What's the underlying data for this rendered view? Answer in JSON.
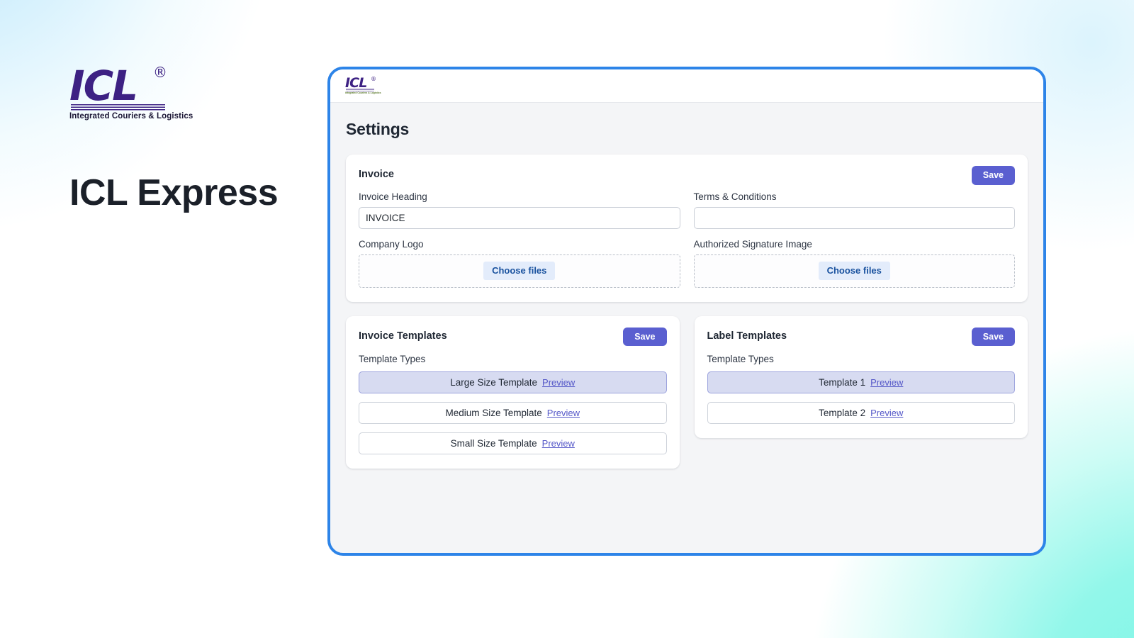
{
  "brand": {
    "logo_wordmark": "ICL",
    "logo_registered": "®",
    "logo_tagline": "Integrated Couriers & Logistics",
    "title": "ICL Express",
    "purple": "#3d2183"
  },
  "app": {
    "border_color": "#2d84e8",
    "body_bg": "#f4f5f7",
    "header": {
      "logo_wordmark": "ICL",
      "logo_registered": "®",
      "logo_tagline": "Integrated Couriers & Logistics"
    },
    "page_title": "Settings"
  },
  "invoice_card": {
    "title": "Invoice",
    "save_label": "Save",
    "save_color": "#5a5fd0",
    "fields": {
      "invoice_heading": {
        "label": "Invoice Heading",
        "value": "INVOICE",
        "placeholder": ""
      },
      "terms_conditions": {
        "label": "Terms & Conditions",
        "value": "",
        "placeholder": ""
      },
      "company_logo": {
        "label": "Company Logo",
        "choose_label": "Choose files"
      },
      "authorized_signature": {
        "label": "Authorized Signature Image",
        "choose_label": "Choose files"
      }
    }
  },
  "invoice_templates_card": {
    "title": "Invoice Templates",
    "save_label": "Save",
    "types_label": "Template Types",
    "preview_label": "Preview",
    "selected_bg": "#d7dbf1",
    "items": [
      {
        "label": "Large Size Template",
        "preview": "Preview",
        "selected": true
      },
      {
        "label": "Medium Size Template",
        "preview": "Preview",
        "selected": false
      },
      {
        "label": "Small Size Template",
        "preview": "Preview",
        "selected": false
      }
    ]
  },
  "label_templates_card": {
    "title": "Label Templates",
    "save_label": "Save",
    "types_label": "Template Types",
    "preview_label": "Preview",
    "items": [
      {
        "label": "Template 1",
        "preview": "Preview",
        "selected": true
      },
      {
        "label": "Template 2",
        "preview": "Preview",
        "selected": false
      }
    ]
  }
}
